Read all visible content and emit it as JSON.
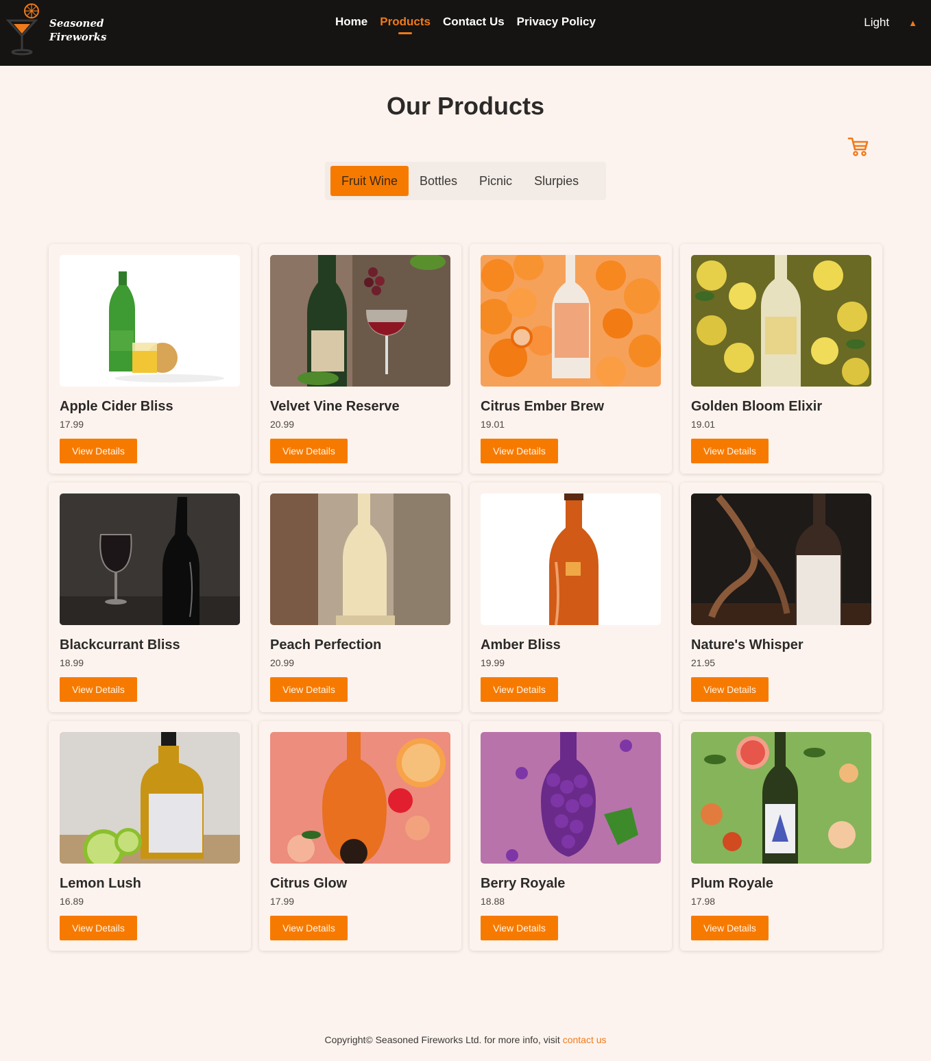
{
  "header": {
    "logo_line1": "Seasoned",
    "logo_line2": "Fireworks",
    "nav": [
      {
        "label": "Home",
        "active": false
      },
      {
        "label": "Products",
        "active": true
      },
      {
        "label": "Contact Us",
        "active": false
      },
      {
        "label": "Privacy Policy",
        "active": false
      }
    ],
    "theme_label": "Light",
    "theme_caret": "▲"
  },
  "page": {
    "title": "Our Products",
    "cart_icon": "cart-icon"
  },
  "tabs": [
    {
      "label": "Fruit Wine",
      "active": true
    },
    {
      "label": "Bottles",
      "active": false
    },
    {
      "label": "Picnic",
      "active": false
    },
    {
      "label": "Slurpies",
      "active": false
    }
  ],
  "products": [
    {
      "name": "Apple Cider Bliss",
      "price": "17.99",
      "button": "View Details"
    },
    {
      "name": "Velvet Vine Reserve",
      "price": "20.99",
      "button": "View Details"
    },
    {
      "name": "Citrus Ember Brew",
      "price": "19.01",
      "button": "View Details"
    },
    {
      "name": "Golden Bloom Elixir",
      "price": "19.01",
      "button": "View Details"
    },
    {
      "name": "Blackcurrant Bliss",
      "price": "18.99",
      "button": "View Details"
    },
    {
      "name": "Peach Perfection",
      "price": "20.99",
      "button": "View Details"
    },
    {
      "name": "Amber Bliss",
      "price": "19.99",
      "button": "View Details"
    },
    {
      "name": "Nature's Whisper",
      "price": "21.95",
      "button": "View Details"
    },
    {
      "name": "Lemon Lush",
      "price": "16.89",
      "button": "View Details"
    },
    {
      "name": "Citrus Glow",
      "price": "17.99",
      "button": "View Details"
    },
    {
      "name": "Berry Royale",
      "price": "18.88",
      "button": "View Details"
    },
    {
      "name": "Plum Royale",
      "price": "17.98",
      "button": "View Details"
    }
  ],
  "footer": {
    "text": "Copyright© Seasoned Fireworks Ltd. for more info, visit ",
    "link": "contact us"
  },
  "colors": {
    "accent": "#f77a00",
    "header_bg": "#161412",
    "page_bg": "#fdf3ee"
  }
}
